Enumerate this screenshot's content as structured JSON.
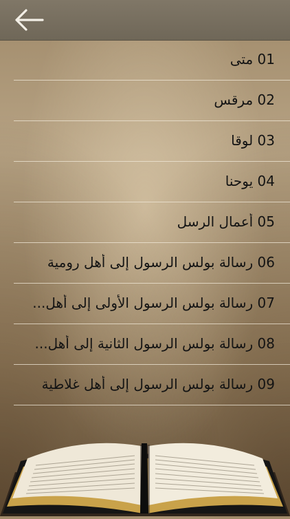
{
  "navbar": {
    "back_icon": "arrow-left-icon"
  },
  "chapters": [
    {
      "number": "01",
      "title": "متى"
    },
    {
      "number": "02",
      "title": "مرقس"
    },
    {
      "number": "03",
      "title": "لوقا"
    },
    {
      "number": "04",
      "title": "يوحنا"
    },
    {
      "number": "05",
      "title": "أعمال الرسل"
    },
    {
      "number": "06",
      "title": "رسالة بولس الرسول  إلى أهل رومية"
    },
    {
      "number": "07",
      "title": "رسالة بولس الرسول الأولى إلى أهل..."
    },
    {
      "number": "08",
      "title": "رسالة بولس الرسول الثانية إلى أهل..."
    },
    {
      "number": "09",
      "title": "رسالة بولس الرسول  إلى أهل غلاطية"
    }
  ],
  "colors": {
    "navbar": "#786f60",
    "text": "#141414",
    "separator": "#f0e8d8"
  }
}
